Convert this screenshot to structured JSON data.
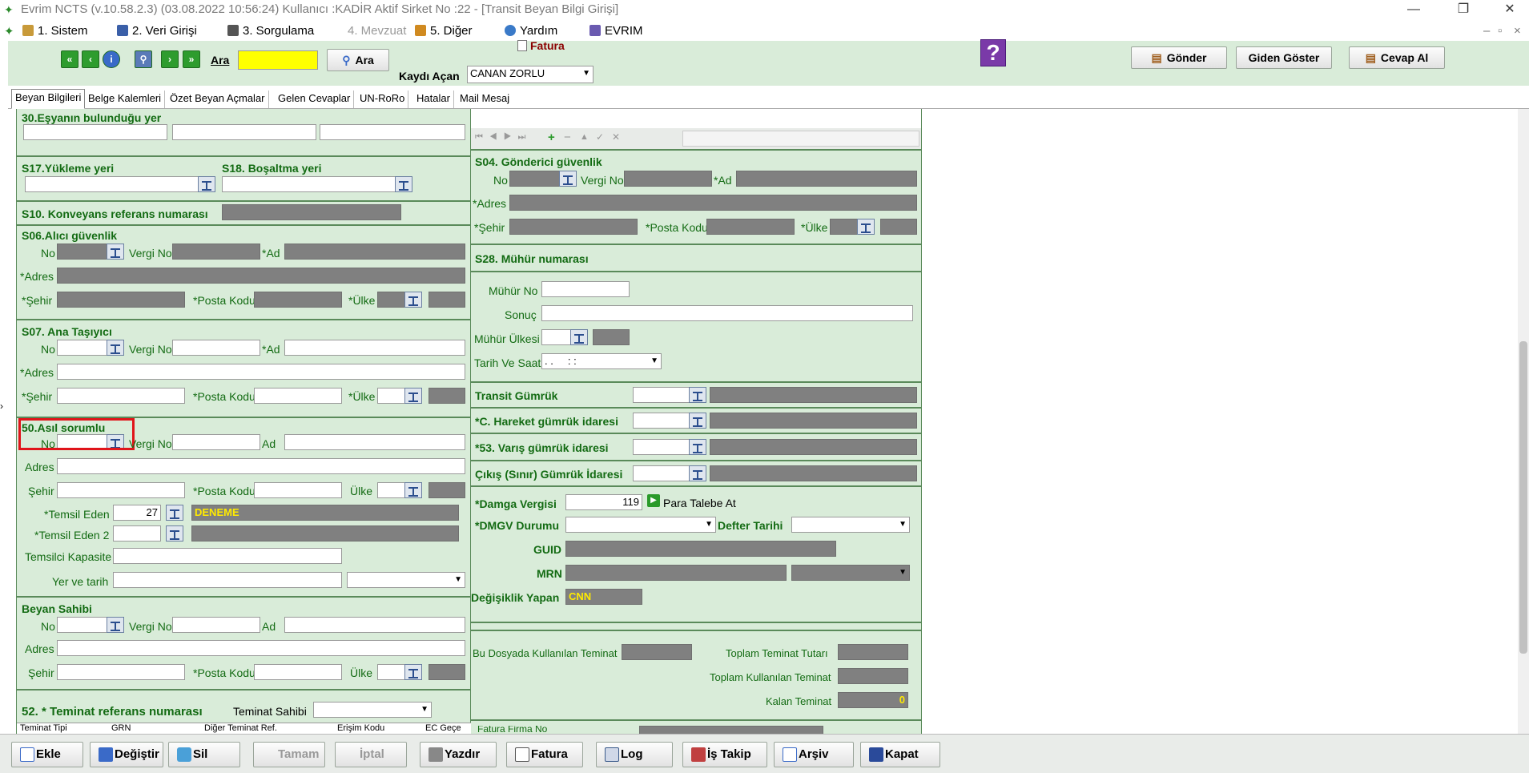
{
  "window": {
    "title": "Evrim NCTS (v.10.58.2.3) (03.08.2022 10:56:24) Kullanıcı :KADİR Aktif Sirket No :22 - [Transit Beyan Bilgi Girişi]"
  },
  "menu": [
    "1. Sistem",
    "2. Veri Girişi",
    "3. Sorgulama",
    "4. Mevzuat",
    "5. Diğer",
    "Yardım",
    "EVRIM"
  ],
  "toolbar": {
    "ara_label": "Ara",
    "ara_button": "Ara",
    "fatura": "Fatura",
    "kaydi_acan_label": "Kaydı Açan",
    "kaydi_acan_value": "CANAN ZORLU",
    "gonder": "Gönder",
    "giden_goster": "Giden Göster",
    "cevap_al": "Cevap Al"
  },
  "tabs": [
    "Beyan Bilgileri",
    "Belge Kalemleri",
    "Özet Beyan Açmalar",
    "Gelen Cevaplar",
    "UN-RoRo",
    "Hatalar",
    "Mail Mesaj"
  ],
  "left": {
    "s30": "30.Eşyanın bulunduğu yer",
    "s17": "S17.Yükleme yeri",
    "s18": "S18. Boşaltma yeri",
    "s10": "S10. Konveyans referans numarası",
    "s06": "S06.Alıcı güvenlik",
    "s07": "S07. Ana Taşıyıcı",
    "s50": "50.Asıl sorumlu",
    "beyan": "Beyan Sahibi",
    "s52": "52. * Teminat referans numarası",
    "teminat_sahibi": "Teminat Sahibi",
    "l_no": "No",
    "l_vergi": "Vergi No",
    "l_ad_req": "*Ad",
    "l_ad": "Ad",
    "l_adres_req": "*Adres",
    "l_adres": "Adres",
    "l_sehir_req": "*Şehir",
    "l_sehir": "Şehir",
    "l_posta": "*Posta Kodu",
    "l_ulke_req": "*Ülke",
    "l_ulke": "Ülke",
    "temsil_eden": "*Temsil Eden",
    "temsil_eden_no": "27",
    "temsil_eden_name": "DENEME",
    "temsil_eden2": "*Temsil Eden 2",
    "temsilci": "Temsilci Kapasite",
    "yer_tarih": "Yer ve tarih",
    "grid_cols": [
      "Teminat Tipi",
      "GRN",
      "Diğer Teminat Ref.",
      "Erişim Kodu",
      "EC Geçe"
    ]
  },
  "right": {
    "s04": "S04. Gönderici güvenlik",
    "s28": "S28. Mühür numarası",
    "muhur_no": "Mühür No",
    "sonuc": "Sonuç",
    "muhur_ulkesi": "Mühür Ülkesi",
    "tarih_saat": "Tarih Ve Saat",
    "tarih_value": ". .     : :",
    "transit": "Transit Gümrük",
    "hareket": "*C. Hareket gümrük idaresi",
    "varis": "*53. Varış gümrük idaresi",
    "cikis": "Çıkış (Sınır) Gümrük İdaresi",
    "damga": "*Damga Vergisi",
    "damga_value": "119",
    "para_talebe": "Para Talebe At",
    "dmgv": "*DMGV Durumu",
    "defter": "Defter Tarihi",
    "guid": "GUID",
    "mrn": "MRN",
    "degisiklik": "Değişiklik Yapan",
    "degisiklik_value": "CNN",
    "bu_dosya": "Bu Dosyada Kullanılan Teminat",
    "toplam_tutar": "Toplam Teminat Tutarı",
    "toplam_kullanilan": "Toplam Kullanılan Teminat",
    "kalan": "Kalan Teminat",
    "kalan_value": "0",
    "fatura_firma": "Fatura Firma No"
  },
  "bottom": [
    "Ekle",
    "Değiştir",
    "Sil",
    "Tamam",
    "İptal",
    "Yazdır",
    "Fatura",
    "Log",
    "İş Takip",
    "Arşiv",
    "Kapat"
  ]
}
